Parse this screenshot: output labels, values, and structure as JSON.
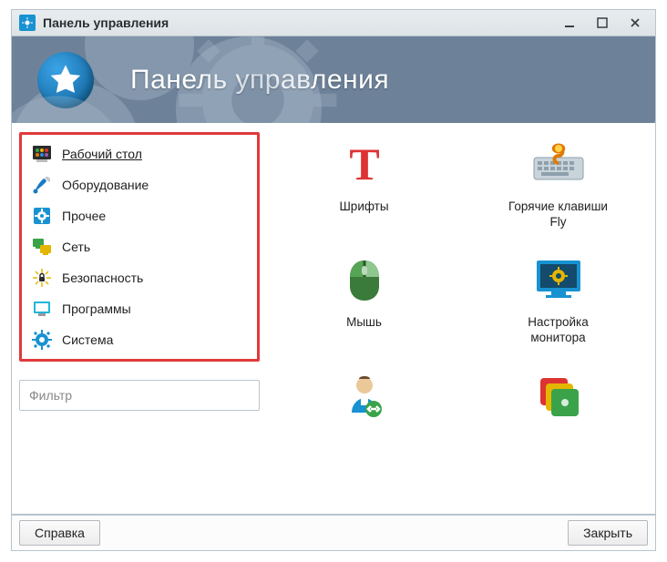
{
  "window": {
    "title": "Панель управления"
  },
  "banner": {
    "heading": "Панель управления"
  },
  "categories": [
    {
      "id": "desktop",
      "label": "Рабочий стол",
      "active": true
    },
    {
      "id": "hardware",
      "label": "Оборудование",
      "active": false
    },
    {
      "id": "other",
      "label": "Прочее",
      "active": false
    },
    {
      "id": "network",
      "label": "Сеть",
      "active": false
    },
    {
      "id": "security",
      "label": "Безопасность",
      "active": false
    },
    {
      "id": "programs",
      "label": "Программы",
      "active": false
    },
    {
      "id": "system",
      "label": "Система",
      "active": false
    }
  ],
  "filter": {
    "placeholder": "Фильтр"
  },
  "apps": [
    {
      "id": "fonts",
      "label": "Шрифты"
    },
    {
      "id": "hotkeys",
      "label": "Горячие клавиши\nFly"
    },
    {
      "id": "mouse",
      "label": "Мышь"
    },
    {
      "id": "monitor",
      "label": "Настройка\nмонитора"
    },
    {
      "id": "users",
      "label": ""
    },
    {
      "id": "themes",
      "label": ""
    }
  ],
  "footer": {
    "help": "Справка",
    "close": "Закрыть"
  }
}
